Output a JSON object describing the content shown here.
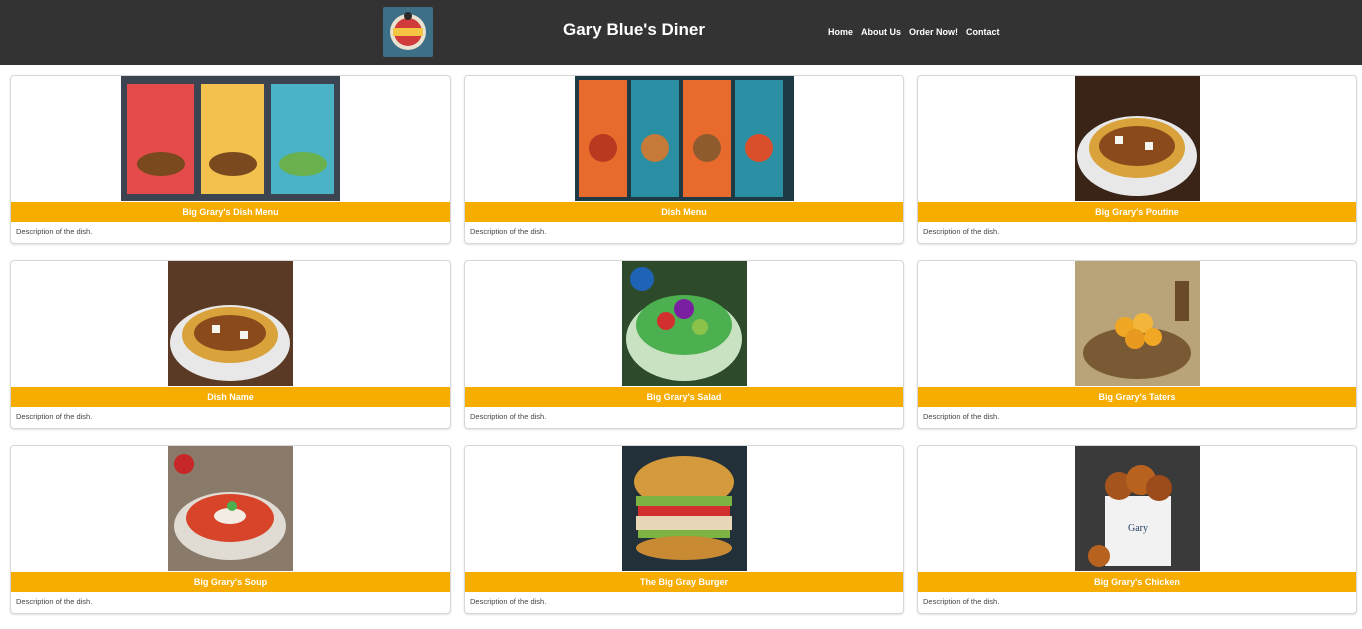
{
  "header": {
    "logo_icon": "diner-logo-icon",
    "title": "Gary Blue's Diner",
    "nav": [
      "Home",
      "About Us",
      "Order Now!",
      "Contact"
    ]
  },
  "dishes": [
    {
      "title": "Big Grary's Dish Menu",
      "description": "Description of the dish.",
      "image": "menu-poster-image"
    },
    {
      "title": "Dish Menu",
      "description": "Description of the dish.",
      "image": "menu-poster-image"
    },
    {
      "title": "Big Grary's Poutine",
      "description": "Description of the dish.",
      "image": "poutine-image"
    },
    {
      "title": "Dish Name",
      "description": "Description of the dish.",
      "image": "poutine-image"
    },
    {
      "title": "Big Grary's Salad",
      "description": "Description of the dish.",
      "image": "salad-image"
    },
    {
      "title": "Big Grary's Taters",
      "description": "Description of the dish.",
      "image": "taters-image"
    },
    {
      "title": "Big Grary's Soup",
      "description": "Description of the dish.",
      "image": "soup-image"
    },
    {
      "title": "The Big Gray Burger",
      "description": "Description of the dish.",
      "image": "burger-image"
    },
    {
      "title": "Big Grary's Chicken",
      "description": "Description of the dish.",
      "image": "chicken-image"
    }
  ],
  "colors": {
    "header_bg": "#333333",
    "accent": "#f6ad00",
    "card_border": "#d7d7d7"
  }
}
